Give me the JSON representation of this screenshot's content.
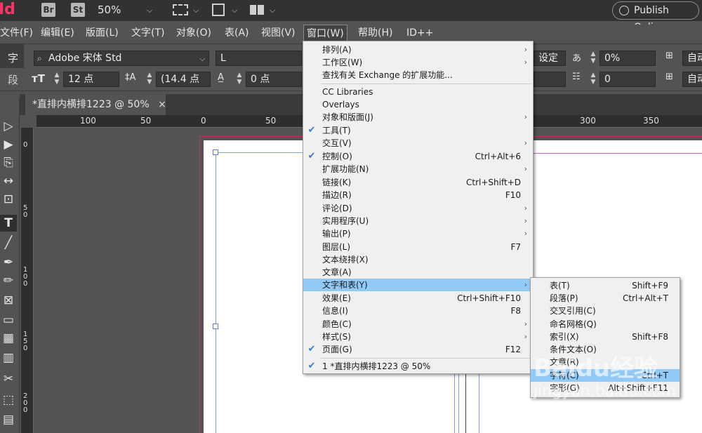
{
  "appbar": {
    "logo": "Id",
    "bridge_badge": "Br",
    "stock_badge": "St",
    "zoom": "50%",
    "publish_label": "Publish Online"
  },
  "menubar": {
    "items": [
      "文件(F)",
      "编辑(E)",
      "版面(L)",
      "文字(T)",
      "对象(O)",
      "表(A)",
      "视图(V)",
      "窗口(W)",
      "帮助(H)",
      "ID++"
    ]
  },
  "control": {
    "char_label": "字",
    "para_label": "段",
    "font_family": "Adobe 宋体 Std",
    "font_style": "L",
    "font_size": "12 点",
    "leading": "(14.4 点",
    "kerning": "0 点",
    "setting_label": "设定",
    "tracking": "0%",
    "baseline": "0",
    "auto1": "自动",
    "auto2": "自动"
  },
  "tab": {
    "title": "*直排内横排1223 @ 50%",
    "close": "×"
  },
  "ruler": {
    "h_ticks": [
      "100",
      "50",
      "0",
      "50",
      "300",
      "350"
    ],
    "v_ticks": [
      "0",
      "50",
      "100",
      "150",
      "200"
    ]
  },
  "window_menu": {
    "items": [
      {
        "label": "排列(A)",
        "shortcut": "",
        "submenu": true,
        "checked": false
      },
      {
        "label": "工作区(W)",
        "shortcut": "",
        "submenu": true,
        "checked": false
      },
      {
        "label": "查找有关 Exchange 的扩展功能...",
        "shortcut": "",
        "submenu": false,
        "checked": false
      },
      {
        "label": "CC Libraries",
        "shortcut": "",
        "submenu": false,
        "checked": false
      },
      {
        "label": "Overlays",
        "shortcut": "",
        "submenu": false,
        "checked": false
      },
      {
        "label": "对象和版面(J)",
        "shortcut": "",
        "submenu": true,
        "checked": false
      },
      {
        "label": "工具(T)",
        "shortcut": "",
        "submenu": false,
        "checked": true
      },
      {
        "label": "交互(V)",
        "shortcut": "",
        "submenu": true,
        "checked": false
      },
      {
        "label": "控制(O)",
        "shortcut": "Ctrl+Alt+6",
        "submenu": false,
        "checked": true
      },
      {
        "label": "扩展功能(N)",
        "shortcut": "",
        "submenu": true,
        "checked": false
      },
      {
        "label": "链接(K)",
        "shortcut": "Ctrl+Shift+D",
        "submenu": false,
        "checked": false
      },
      {
        "label": "描边(R)",
        "shortcut": "F10",
        "submenu": false,
        "checked": false
      },
      {
        "label": "评论(D)",
        "shortcut": "",
        "submenu": true,
        "checked": false
      },
      {
        "label": "实用程序(U)",
        "shortcut": "",
        "submenu": true,
        "checked": false
      },
      {
        "label": "输出(P)",
        "shortcut": "",
        "submenu": true,
        "checked": false
      },
      {
        "label": "图层(L)",
        "shortcut": "F7",
        "submenu": false,
        "checked": false
      },
      {
        "label": "文本绕排(X)",
        "shortcut": "",
        "submenu": false,
        "checked": false
      },
      {
        "label": "文章(A)",
        "shortcut": "",
        "submenu": false,
        "checked": false
      },
      {
        "label": "文字和表(Y)",
        "shortcut": "",
        "submenu": true,
        "checked": false
      },
      {
        "label": "效果(E)",
        "shortcut": "Ctrl+Shift+F10",
        "submenu": false,
        "checked": false
      },
      {
        "label": "信息(I)",
        "shortcut": "F8",
        "submenu": false,
        "checked": false
      },
      {
        "label": "颜色(C)",
        "shortcut": "",
        "submenu": true,
        "checked": false
      },
      {
        "label": "样式(S)",
        "shortcut": "",
        "submenu": true,
        "checked": false
      },
      {
        "label": "页面(G)",
        "shortcut": "F12",
        "submenu": false,
        "checked": true
      },
      {
        "label": "1 *直排内横排1223 @ 50%",
        "shortcut": "",
        "submenu": false,
        "checked": true
      }
    ]
  },
  "sub_menu": {
    "items": [
      {
        "label": "表(T)",
        "shortcut": "Shift+F9"
      },
      {
        "label": "段落(P)",
        "shortcut": "Ctrl+Alt+T"
      },
      {
        "label": "交叉引用(C)",
        "shortcut": ""
      },
      {
        "label": "命名网格(Q)",
        "shortcut": ""
      },
      {
        "label": "索引(X)",
        "shortcut": "Shift+F8"
      },
      {
        "label": "条件文本(O)",
        "shortcut": ""
      },
      {
        "label": "文章(R)",
        "shortcut": ""
      },
      {
        "label": "字符(C)",
        "shortcut": "Ctrl+T"
      },
      {
        "label": "字形(G)",
        "shortcut": "Alt+Shift+F11"
      }
    ]
  },
  "watermark": {
    "brand": "Baidu经验",
    "url": "jingyan.baidu.com"
  }
}
